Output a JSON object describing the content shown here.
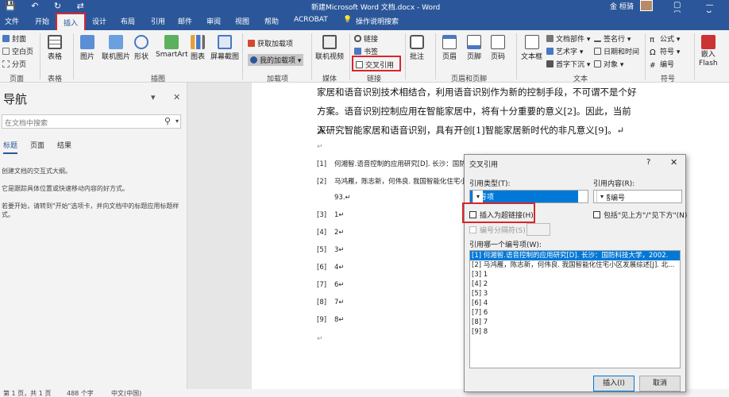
{
  "title_bar": {
    "quick_access": "💾 ↶ ↻ ⇄",
    "doc_title": "新建Microsoft Word 文档.docx  -  Word",
    "user": "金 桓骑",
    "window_buttons": "▢ — ▢ ✕"
  },
  "tabs": [
    "文件",
    "开始",
    "插入",
    "设计",
    "布局",
    "引用",
    "邮件",
    "审阅",
    "视图",
    "帮助",
    "ACROBAT"
  ],
  "tab_search": "操作说明搜索",
  "ribbon": {
    "pages_items": [
      "封面",
      "空白页",
      "分页"
    ],
    "group_labels": {
      "pages": "页面",
      "table": "表格",
      "illustrations": "插图",
      "addins": "加载项",
      "media": "媒体",
      "links": "链接",
      "header_footer": "页眉和页脚",
      "text": "文本",
      "symbols": "符号"
    },
    "table": "表格",
    "illustrations": [
      "图片",
      "联机图片",
      "形状",
      "SmartArt",
      "图表",
      "屏幕截图"
    ],
    "addins": {
      "get": "获取加载项",
      "mine": "我的加载项"
    },
    "media": "联机视频",
    "links": {
      "link": "链接",
      "bookmark": "书签",
      "crossref": "交叉引用"
    },
    "comment": "批注",
    "header_footer": [
      "页眉",
      "页脚",
      "页码"
    ],
    "text_box": "文本框",
    "text_items": [
      "文档部件",
      "艺术字",
      "首字下沉"
    ],
    "text_items2": [
      "签名行",
      "日期和时间",
      "对象"
    ],
    "symbols": [
      "公式",
      "符号",
      "编号"
    ],
    "flash": "嵌入\nFlash",
    "flash_group": "Flash"
  },
  "nav": {
    "title": "导航",
    "search_placeholder": "在文档中搜索",
    "tabs": [
      "标题",
      "页面",
      "结果"
    ],
    "hint1": "创建文档的交互式大纲。",
    "hint2": "它是跟踪具体位置或快速移动内容的好方式。",
    "hint3": "若要开始，请转到\"开始\"选项卡，并向文档中的标题应用标题样式。"
  },
  "document": {
    "lines": [
      "家居和语音识别技术相结合，利用语音识别作为新的控制手段，不可谓不是个好",
      "方案。语音识别控制应用在智能家居中，将有十分重要的意义[2]。因此，当前深",
      "入研究智能家居和语音识别，具有开创[1]智能家居新时代的非凡意义[9]。↵"
    ],
    "refs": [
      {
        "n": "[1]",
        "t": "何湘智.语音控制的应用研究[D]. 长沙：国防"
      },
      {
        "n": "[2]",
        "t": "马鸿雁，陈志新，何伟良. 我国智能化住宅小"
      },
      {
        "n": "",
        "t": "93.↵"
      },
      {
        "n": "[3]",
        "t": "1↵"
      },
      {
        "n": "[4]",
        "t": "2↵"
      },
      {
        "n": "[5]",
        "t": "3↵"
      },
      {
        "n": "[6]",
        "t": "4↵"
      },
      {
        "n": "[7]",
        "t": "6↵"
      },
      {
        "n": "[8]",
        "t": "7↵"
      },
      {
        "n": "[9]",
        "t": "8↵"
      }
    ],
    "para_marks": [
      "↵",
      "↵"
    ]
  },
  "dialog": {
    "title": "交叉引用",
    "help": "?",
    "close": "✕",
    "ref_type_label": "引用类型(T):",
    "ref_type_value": "编号项",
    "ref_content_label": "引用内容(R):",
    "ref_content_value": "段落编号",
    "insert_hyperlink": "插入为超链接(H)",
    "include_above_below": "包括\"见上方\"/\"见下方\"(N)",
    "separator": "编号分隔符(S)",
    "which_label": "引用哪一个编号项(W):",
    "items": [
      "[1] 何湘智.语音控制的应用研究[D]. 长沙：国防科技大学，2002.",
      "[2] 马鸿雁，陈志新，何伟良. 我国智能化住宅小区发展综述[J]. 北...",
      "[3] 1",
      "[4] 2",
      "[5] 3",
      "[6] 4",
      "[7] 6",
      "[8] 7",
      "[9] 8"
    ],
    "insert_btn": "插入(I)",
    "cancel_btn": "取消"
  },
  "status": [
    "第 1 页，共 1 页",
    "488 个字",
    "中文(中国)"
  ]
}
